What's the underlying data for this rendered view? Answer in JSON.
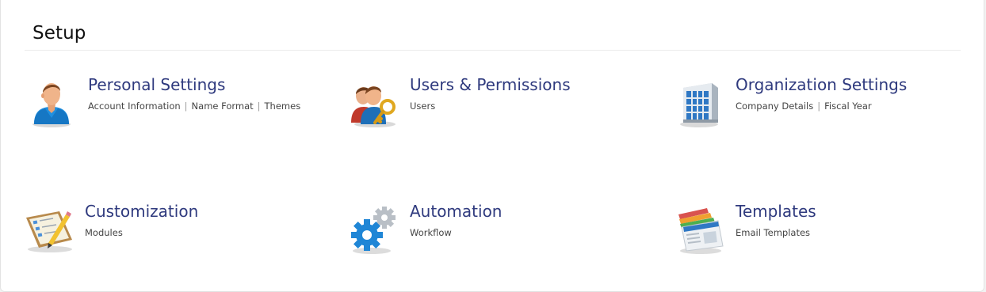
{
  "page": {
    "title": "Setup"
  },
  "tiles": {
    "personal": {
      "title": "Personal Settings",
      "icon": "user-icon",
      "links": [
        "Account Information",
        "Name Format",
        "Themes"
      ]
    },
    "users": {
      "title": "Users & Permissions",
      "icon": "users-key-icon",
      "links": [
        "Users"
      ]
    },
    "organization": {
      "title": "Organization Settings",
      "icon": "building-icon",
      "links": [
        "Company Details",
        "Fiscal Year"
      ]
    },
    "customization": {
      "title": "Customization",
      "icon": "checklist-pencil-icon",
      "links": [
        "Modules"
      ]
    },
    "automation": {
      "title": "Automation",
      "icon": "gears-icon",
      "links": [
        "Workflow"
      ]
    },
    "templates": {
      "title": "Templates",
      "icon": "templates-icon",
      "links": [
        "Email Templates"
      ]
    }
  },
  "separator": "|",
  "colors": {
    "title": "#2f3a7e",
    "link": "#444444",
    "accent_blue": "#1e88d8"
  }
}
